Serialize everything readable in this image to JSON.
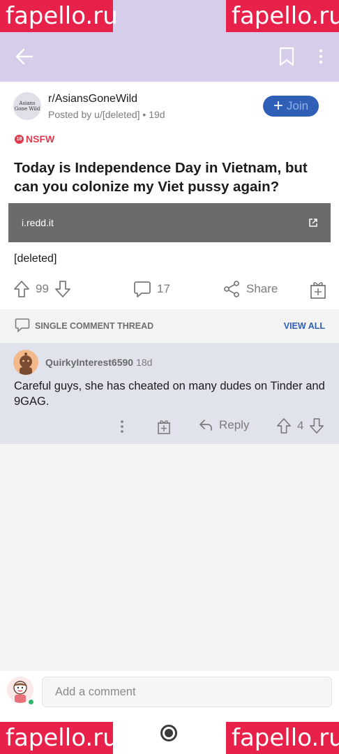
{
  "watermark": "fapello.ru",
  "post": {
    "subreddit_avatar_text": "Asians Gone Wild",
    "subreddit": "r/AsiansGoneWild",
    "posted_by": "Posted by u/[deleted] • 19d",
    "join_label": "Join",
    "nsfw_label": "NSFW",
    "nsfw_badge": "18",
    "title": "Today is Independence Day in Vietnam, but can you colonize my Viet pussy again?",
    "link_domain": "i.redd.it",
    "body": "[deleted]",
    "upvotes": "99",
    "comments": "17",
    "share_label": "Share"
  },
  "thread": {
    "label": "SINGLE COMMENT THREAD",
    "view_all": "VIEW ALL"
  },
  "comment": {
    "author": "QuirkyInterest6590",
    "age": "18d",
    "text": "Careful guys, she has cheated on many dudes on Tinder and 9GAG.",
    "reply_label": "Reply",
    "score": "4"
  },
  "footer": {
    "placeholder": "Add a comment"
  },
  "colors": {
    "appbar": "#d5cdea",
    "join": "#2f5fb7",
    "nsfw": "#e03a4e",
    "comment_bg": "#e0e3ec"
  }
}
